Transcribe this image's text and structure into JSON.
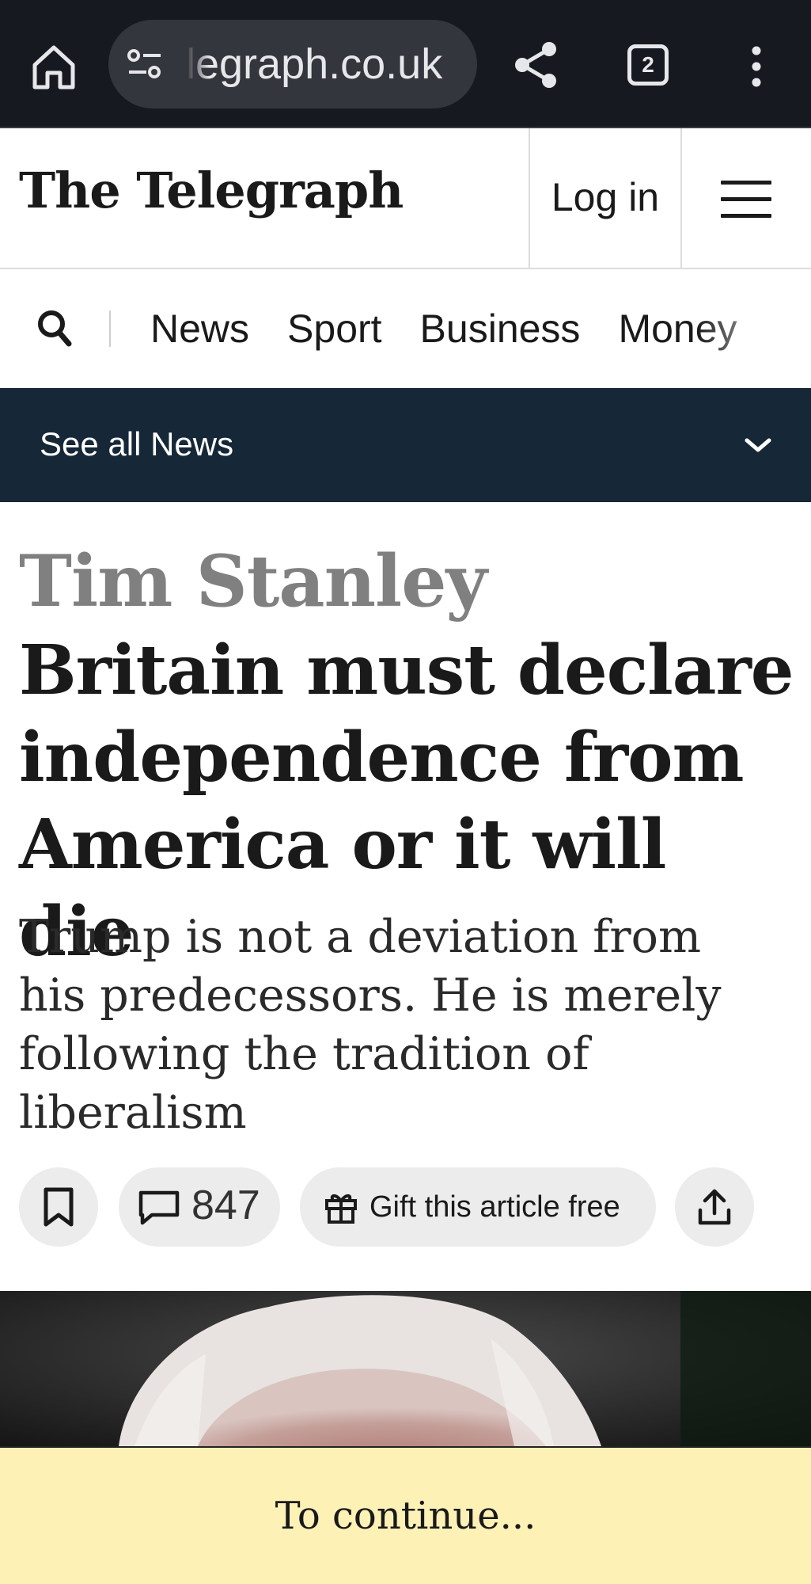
{
  "browser": {
    "url_text": "legraph.co.uk",
    "tab_count": "2",
    "icons": [
      "home-icon",
      "site-settings-icon",
      "share-icon",
      "tab-switcher-icon",
      "more-vert-icon"
    ],
    "colors": {
      "toolbar": "#161a20",
      "urlbar": "#33363c"
    }
  },
  "header": {
    "logo": "The Telegraph",
    "login_label": "Log in",
    "menu_icon": "hamburger-icon"
  },
  "nav": {
    "items": [
      "News",
      "Sport",
      "Business",
      "Money"
    ],
    "search_icon": "search-icon"
  },
  "subnav": {
    "label": "See all News",
    "icon": "chevron-down-icon",
    "color": "#162737"
  },
  "article": {
    "author": "Tim Stanley",
    "headline": "Britain must declare independence from America or it will die",
    "standfirst": "Trump is not a deviation from his predecessors. He is merely following the tradition of liberalism",
    "actions": {
      "comment_count": "847",
      "gift_label": "Gift this article free"
    }
  },
  "banner": {
    "text": "To continue...",
    "color": "#fdf1b5"
  }
}
